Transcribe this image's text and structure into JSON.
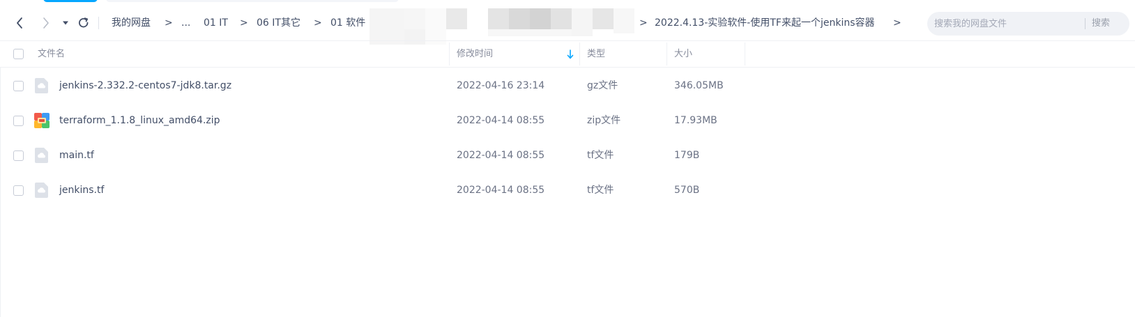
{
  "toolbar": {
    "back_icon": "chevron-left-icon",
    "forward_icon": "chevron-right-icon",
    "history_icon": "caret-down-icon",
    "refresh_icon": "refresh-icon",
    "breadcrumb": [
      {
        "label": "我的网盘"
      },
      {
        "label": "..."
      },
      {
        "label": "01 IT"
      },
      {
        "label": "06 IT其它"
      },
      {
        "label": "01 软件"
      },
      {
        "label": "2022.4.13-实验软件-使用TF来起一个jenkins容器"
      }
    ],
    "separator": ">"
  },
  "search": {
    "placeholder": "搜索我的网盘文件",
    "value": "",
    "button_label": "搜索"
  },
  "table": {
    "headers": {
      "name": "文件名",
      "modified": "修改时间",
      "type": "类型",
      "size": "大小"
    },
    "sort_icon": "arrow-down-icon",
    "rows": [
      {
        "name": "jenkins-2.332.2-centos7-jdk8.tar.gz",
        "modified": "2022-04-16 23:14",
        "type": "gz文件",
        "size": "346.05MB",
        "icon": "generic-file-icon"
      },
      {
        "name": "terraform_1.1.8_linux_amd64.zip",
        "modified": "2022-04-14 08:55",
        "type": "zip文件",
        "size": "17.93MB",
        "icon": "zip-archive-icon"
      },
      {
        "name": "main.tf",
        "modified": "2022-04-14 08:55",
        "type": "tf文件",
        "size": "179B",
        "icon": "generic-file-icon"
      },
      {
        "name": "jenkins.tf",
        "modified": "2022-04-14 08:55",
        "type": "tf文件",
        "size": "570B",
        "icon": "generic-file-icon"
      }
    ]
  },
  "colors": {
    "accent": "#06a7ff",
    "text": "#424e67",
    "muted": "#878c9c",
    "search_bg": "#f0f2f6"
  }
}
